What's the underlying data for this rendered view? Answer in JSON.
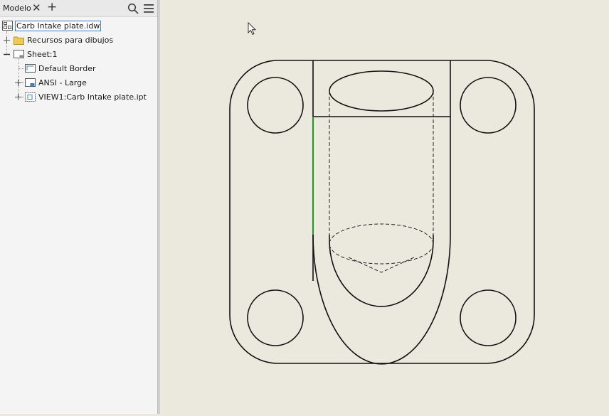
{
  "browser": {
    "tab_label": "Modelo",
    "tree": [
      {
        "label": "Carb Intake plate.idw",
        "icon": "drawing-document-icon"
      },
      {
        "label": "Recursos para dibujos",
        "icon": "folder-icon"
      },
      {
        "label": "Sheet:1",
        "icon": "sheet-icon"
      },
      {
        "label": "Default Border",
        "icon": "border-icon"
      },
      {
        "label": "ANSI - Large",
        "icon": "title-block-icon"
      },
      {
        "label": "VIEW1:Carb Intake plate.ipt",
        "icon": "drawing-view-icon"
      }
    ]
  },
  "colors": {
    "canvas_bg": "#ebe9de",
    "panel_bg": "#f4f4f4",
    "line": "#111111",
    "highlight_edge": "#1f9a1f",
    "selection_outline": "#3c7fc6"
  }
}
